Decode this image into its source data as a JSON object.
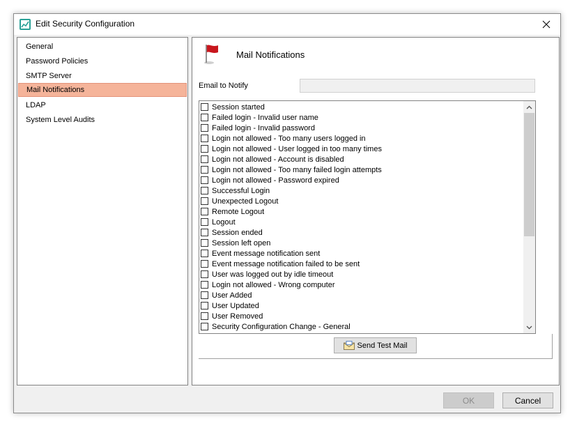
{
  "window": {
    "title": "Edit Security Configuration",
    "accent_color": "#2aa197"
  },
  "sidebar": {
    "items": [
      {
        "label": "General"
      },
      {
        "label": "Password Policies"
      },
      {
        "label": "SMTP Server"
      },
      {
        "label": "Mail Notifications",
        "selected": true
      },
      {
        "label": "LDAP"
      },
      {
        "label": "System Level Audits"
      }
    ],
    "selected_color": "#f5b49a"
  },
  "main": {
    "title": "Mail Notifications",
    "icon": "red-flag-icon",
    "email_label": "Email to Notify",
    "email_value": "",
    "notifications": [
      {
        "label": "Session started",
        "checked": false
      },
      {
        "label": "Failed login - Invalid user name",
        "checked": false
      },
      {
        "label": "Failed login - Invalid password",
        "checked": false
      },
      {
        "label": "Login not allowed - Too many users logged in",
        "checked": false
      },
      {
        "label": "Login not allowed - User logged in too many times",
        "checked": false
      },
      {
        "label": "Login not allowed - Account is disabled",
        "checked": false
      },
      {
        "label": "Login not allowed - Too many failed login attempts",
        "checked": false
      },
      {
        "label": "Login not allowed - Password expired",
        "checked": false
      },
      {
        "label": "Successful Login",
        "checked": false
      },
      {
        "label": "Unexpected Logout",
        "checked": false
      },
      {
        "label": "Remote Logout",
        "checked": false
      },
      {
        "label": "Logout",
        "checked": false
      },
      {
        "label": "Session ended",
        "checked": false
      },
      {
        "label": "Session left open",
        "checked": false
      },
      {
        "label": "Event message notification sent",
        "checked": false
      },
      {
        "label": "Event message notification failed to be sent",
        "checked": false
      },
      {
        "label": "User was logged out by idle timeout",
        "checked": false
      },
      {
        "label": "Login not allowed - Wrong computer",
        "checked": false
      },
      {
        "label": "User Added",
        "checked": false
      },
      {
        "label": "User Updated",
        "checked": false
      },
      {
        "label": "User Removed",
        "checked": false
      },
      {
        "label": "Security Configuration Change - General",
        "checked": false
      }
    ],
    "send_test_label": "Send Test Mail"
  },
  "footer": {
    "ok_label": "OK",
    "cancel_label": "Cancel"
  }
}
